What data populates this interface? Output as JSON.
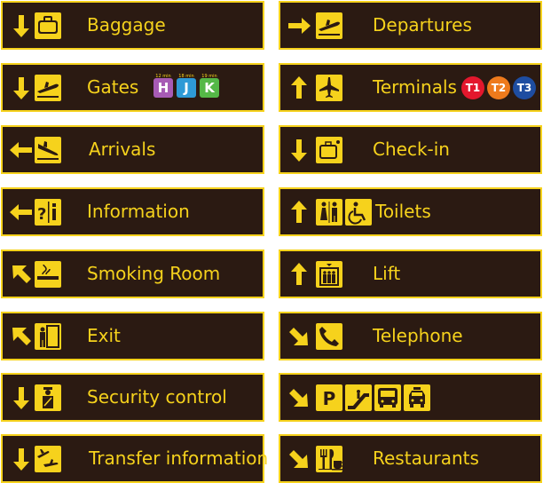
{
  "colors": {
    "sign_bg": "#2b1a12",
    "accent": "#f6d21c"
  },
  "signs": {
    "baggage": {
      "label": "Baggage",
      "arrow": "arrow-down",
      "icons": [
        "baggage-icon"
      ]
    },
    "gates": {
      "label": "Gates",
      "arrow": "arrow-down",
      "icons": [
        "departure-plane-icon"
      ],
      "gates": [
        {
          "letter": "H",
          "minutes": "12 min",
          "color": "#a75bb5"
        },
        {
          "letter": "J",
          "minutes": "18 min",
          "color": "#2e9ad6"
        },
        {
          "letter": "K",
          "minutes": "19 min",
          "color": "#55b847"
        }
      ]
    },
    "arrivals": {
      "label": "Arrivals",
      "arrow": "arrow-left",
      "icons": [
        "arrival-plane-icon"
      ]
    },
    "information": {
      "label": "Information",
      "arrow": "arrow-left",
      "icons": [
        "information-icon"
      ]
    },
    "smoking": {
      "label": "Smoking Room",
      "arrow": "arrow-up-left",
      "icons": [
        "smoking-icon"
      ]
    },
    "exit": {
      "label": "Exit",
      "arrow": "arrow-up-left",
      "icons": [
        "exit-door-icon"
      ]
    },
    "security": {
      "label": "Security control",
      "arrow": "arrow-down",
      "icons": [
        "security-officer-icon"
      ]
    },
    "transfer": {
      "label": "Transfer information",
      "arrow": "arrow-down",
      "icons": [
        "transfer-planes-icon"
      ]
    },
    "departures": {
      "label": "Departures",
      "arrow": "arrow-right",
      "icons": [
        "departure-plane-icon"
      ]
    },
    "terminals": {
      "label": "Terminals",
      "arrow": "arrow-up",
      "icons": [
        "plane-icon"
      ],
      "terminals": [
        {
          "name": "T1",
          "color": "#e3172d"
        },
        {
          "name": "T2",
          "color": "#ee7a1c"
        },
        {
          "name": "T3",
          "color": "#1e4da1"
        }
      ]
    },
    "checkin": {
      "label": "Check-in",
      "arrow": "arrow-down",
      "icons": [
        "check-in-luggage-icon"
      ]
    },
    "toilets": {
      "label": "Toilets",
      "arrow": "arrow-up",
      "icons": [
        "toilets-icon",
        "wheelchair-icon"
      ]
    },
    "lift": {
      "label": "Lift",
      "arrow": "arrow-up",
      "icons": [
        "lift-icon"
      ]
    },
    "telephone": {
      "label": "Telephone",
      "arrow": "arrow-down-right",
      "icons": [
        "telephone-icon"
      ]
    },
    "parking": {
      "label": "",
      "arrow": "arrow-down-right",
      "icons": [
        "parking-icon",
        "escalator-icon",
        "bus-icon",
        "taxi-icon"
      ],
      "parking_letter": "P"
    },
    "restaurants": {
      "label": "Restaurants",
      "arrow": "arrow-down-right",
      "icons": [
        "restaurant-icon",
        "cafe-icon"
      ]
    }
  }
}
